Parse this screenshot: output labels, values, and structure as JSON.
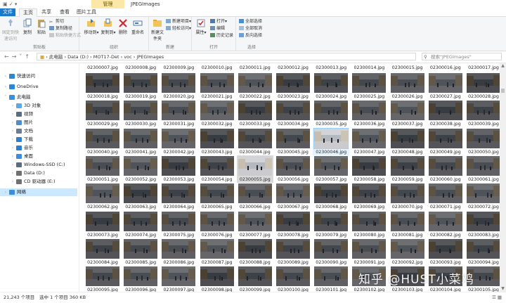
{
  "window": {
    "context_tab": "管理",
    "title": "JPEGImages"
  },
  "tabs": [
    "文件",
    "主页",
    "共享",
    "查看",
    "图片工具"
  ],
  "ribbon": {
    "clipboard": {
      "label": "剪贴板",
      "pin": "固定到快速访问",
      "copy": "复制",
      "paste": "粘贴",
      "cut": "剪切",
      "copy_path": "复制路径",
      "paste_shortcut": "粘贴快捷方式"
    },
    "organize": {
      "label": "组织",
      "move_to": "移动到",
      "copy_to": "复制到",
      "delete": "删除",
      "rename": "重命名"
    },
    "new": {
      "label": "新建",
      "new_folder": "新建文件夹",
      "new_item": "新建项目",
      "easy_access": "轻松访问"
    },
    "open": {
      "label": "打开",
      "properties": "属性",
      "open": "打开",
      "edit": "编辑",
      "history": "历史记录"
    },
    "select": {
      "label": "选择",
      "select_all": "全部选择",
      "select_none": "全部取消",
      "invert": "反向选择"
    }
  },
  "address": {
    "path": [
      "此电脑",
      "Data (D:)",
      "MOT17-Det",
      "voc",
      "JPEGImages"
    ],
    "search_placeholder": "搜索\"JPEGImages\""
  },
  "nav": {
    "items": [
      {
        "label": "快速访问",
        "level": 0,
        "icon": "star-icon",
        "color": "#2b87d3"
      },
      {
        "label": "OneDrive",
        "level": 0,
        "icon": "cloud-icon",
        "color": "#2b87d3"
      },
      {
        "label": "此电脑",
        "level": 0,
        "icon": "computer-icon",
        "color": "#3a8ee0"
      },
      {
        "label": "3D 对象",
        "level": 1,
        "icon": "cube-icon",
        "color": "#5aa9e6"
      },
      {
        "label": "视频",
        "level": 1,
        "icon": "video-icon",
        "color": "#5a6c80"
      },
      {
        "label": "图片",
        "level": 1,
        "icon": "picture-icon",
        "color": "#4a8fd0"
      },
      {
        "label": "文档",
        "level": 1,
        "icon": "document-icon",
        "color": "#6c7c90"
      },
      {
        "label": "下载",
        "level": 1,
        "icon": "download-icon",
        "color": "#2e7fd0"
      },
      {
        "label": "音乐",
        "level": 1,
        "icon": "music-icon",
        "color": "#2e7fd0"
      },
      {
        "label": "桌面",
        "level": 1,
        "icon": "desktop-icon",
        "color": "#3a8ee0"
      },
      {
        "label": "Windows-SSD (C:)",
        "level": 1,
        "icon": "drive-icon",
        "color": "#5a6c80"
      },
      {
        "label": "Data (D:)",
        "level": 1,
        "icon": "drive-icon",
        "color": "#707070"
      },
      {
        "label": "CD 驱动器 (E:)",
        "level": 1,
        "icon": "cd-icon",
        "color": "#707070"
      },
      {
        "label": "网络",
        "level": 0,
        "icon": "network-icon",
        "color": "#3a8ee0",
        "selected": true
      }
    ]
  },
  "files": {
    "top_labels": [
      "02300007.jpg",
      "02300008.jpg",
      "02300009.jpg",
      "02300010.jpg",
      "02300011.jpg",
      "02300012.jpg",
      "02300013.jpg",
      "02300014.jpg",
      "02300015.jpg",
      "02300016.jpg",
      "02300017.jpg"
    ],
    "rows": [
      [
        "02300018.jpg",
        "02300019.jpg",
        "02300020.jpg",
        "02300021.jpg",
        "02300022.jpg",
        "02300023.jpg",
        "02300024.jpg",
        "02300025.jpg",
        "02300026.jpg",
        "02300027.jpg",
        "02300028.jpg"
      ],
      [
        "02300029.jpg",
        "02300030.jpg",
        "02300031.jpg",
        "02300032.jpg",
        "02300033.jpg",
        "02300034.jpg",
        "02300035.jpg",
        "02300036.jpg",
        "02300037.jpg",
        "02300038.jpg",
        "02300039.jpg"
      ],
      [
        "02300040.jpg",
        "02300041.jpg",
        "02300042.jpg",
        "02300043.jpg",
        "02300044.jpg",
        "02300045.jpg",
        "02300046.jpg",
        "02300047.jpg",
        "02300048.jpg",
        "02300049.jpg",
        "02300050.jpg"
      ],
      [
        "02300051.jpg",
        "02300052.jpg",
        "02300053.jpg",
        "02300054.jpg",
        "02300055.jpg",
        "02300056.jpg",
        "02300057.jpg",
        "02300058.jpg",
        "02300059.jpg",
        "02300060.jpg",
        "02300061.jpg"
      ],
      [
        "02300062.jpg",
        "02300063.jpg",
        "02300064.jpg",
        "02300065.jpg",
        "02300066.jpg",
        "02300067.jpg",
        "02300068.jpg",
        "02300069.jpg",
        "02300070.jpg",
        "02300071.jpg",
        "02300072.jpg"
      ],
      [
        "02300073.jpg",
        "02300074.jpg",
        "02300075.jpg",
        "02300076.jpg",
        "02300077.jpg",
        "02300078.jpg",
        "02300079.jpg",
        "02300080.jpg",
        "02300081.jpg",
        "02300082.jpg",
        "02300083.jpg"
      ],
      [
        "02300084.jpg",
        "02300085.jpg",
        "02300086.jpg",
        "02300087.jpg",
        "02300088.jpg",
        "02300089.jpg",
        "02300090.jpg",
        "02300091.jpg",
        "02300092.jpg",
        "02300093.jpg",
        "02300094.jpg"
      ],
      [
        "02300095.jpg",
        "02300096.jpg",
        "02300097.jpg",
        "02300098.jpg",
        "02300099.jpg",
        "02300100.jpg",
        "02300101.jpg",
        "02300102.jpg",
        "02300103.jpg",
        "02300104.jpg",
        "02300105.jpg"
      ]
    ],
    "selected": "02300046.jpg",
    "hovered": "02300055.jpg"
  },
  "status": {
    "count": "21,243 个项目",
    "selection": "选中 1 个项目  360 KB"
  },
  "watermark": "知乎 @HUST小菜鸡"
}
